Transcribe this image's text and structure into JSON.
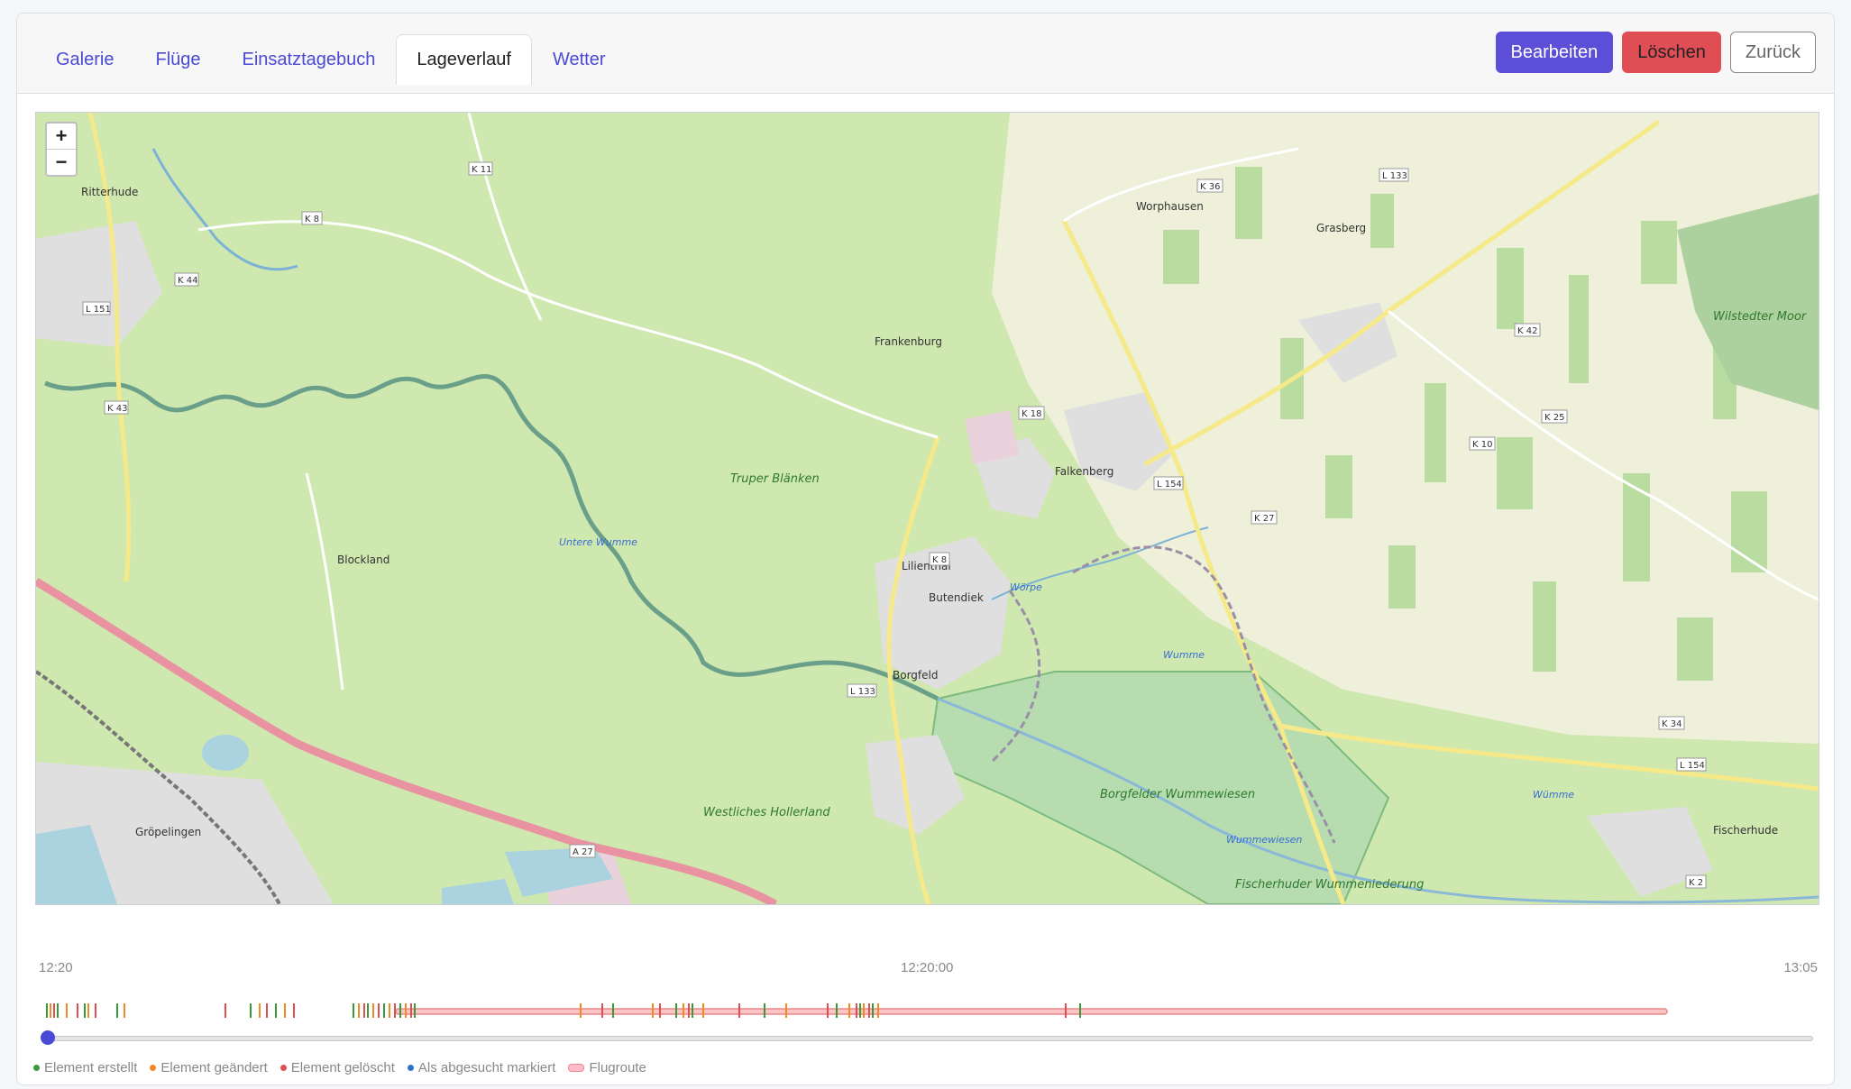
{
  "tabs": [
    {
      "label": "Galerie",
      "active": false
    },
    {
      "label": "Flüge",
      "active": false
    },
    {
      "label": "Einsatztagebuch",
      "active": false
    },
    {
      "label": "Lageverlauf",
      "active": true
    },
    {
      "label": "Wetter",
      "active": false
    }
  ],
  "actions": {
    "edit": "Bearbeiten",
    "delete": "Löschen",
    "back": "Zurück"
  },
  "map": {
    "zoom_in": "+",
    "zoom_out": "−",
    "places": [
      "Ritterhude",
      "Worphausen",
      "Grasberg",
      "Frankenburg",
      "Falkenberg",
      "Lilienthal",
      "Butendiek",
      "Borgfeld",
      "Blockland",
      "Gröpelingen",
      "Fischerhude",
      "Wilstedter Moor",
      "Truper Blänken",
      "Westliches Hollerland"
    ],
    "water_labels": [
      "Wumme",
      "Wümme",
      "Untere Wumme",
      "Wummewiesen",
      "Wörpe"
    ],
    "area_labels": [
      "Borgfelder Wummewiesen",
      "Fischerhuder Wummeniederung"
    ],
    "roads": [
      "K 11",
      "K 8",
      "K 44",
      "L 151",
      "K 43",
      "K 36",
      "L 133",
      "K 42",
      "K 25",
      "K 10",
      "K 18",
      "L 154",
      "K 27",
      "K 8",
      "L 133",
      "A 27",
      "K 34",
      "L 154",
      "K 2"
    ],
    "colors": {
      "grass": "#cfe8b0",
      "farmland": "#eef0d9",
      "forest": "#add19e",
      "water": "#aad3df",
      "motorway": "#e892a2",
      "road": "#f7fabf",
      "boundary": "#9b8fa8"
    }
  },
  "timeline": {
    "start_label": "12:20",
    "mid_label": "12:20:00",
    "end_label": "13:05",
    "slider_value": 0
  },
  "legend": [
    {
      "label": "Element erstellt",
      "color": "#3a9a3a"
    },
    {
      "label": "Element geändert",
      "color": "#f08a24"
    },
    {
      "label": "Element gelöscht",
      "color": "#e04e55"
    },
    {
      "label": "Als abgesucht markiert",
      "color": "#2a74c9"
    },
    {
      "label": "Flugroute",
      "color": "#e88888"
    }
  ]
}
